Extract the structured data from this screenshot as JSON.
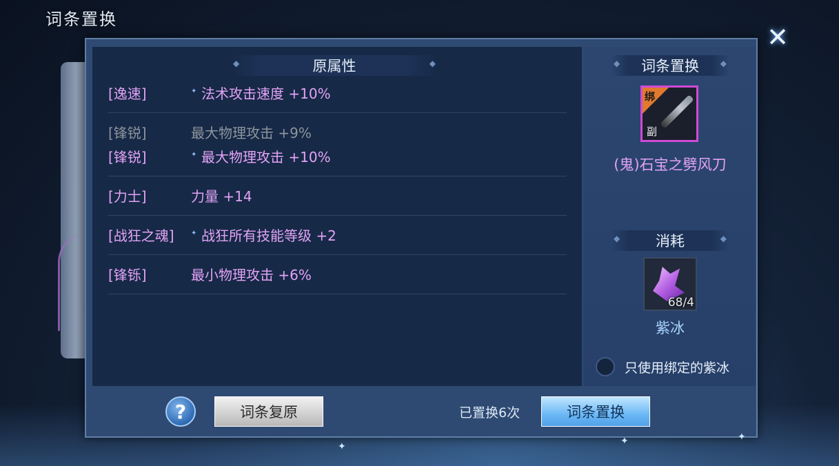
{
  "window": {
    "title": "词条置换",
    "close_icon": "close-icon"
  },
  "left": {
    "header": "原属性",
    "rows": [
      {
        "tag": "[逸速]",
        "desc": "法术攻击速度 +10%",
        "starred": true,
        "old": false
      },
      {
        "tag": "[锋锐]",
        "desc": "最大物理攻击 +9%",
        "starred": false,
        "old": true
      },
      {
        "tag": "[锋锐]",
        "desc": "最大物理攻击 +10%",
        "starred": true,
        "old": false
      },
      {
        "tag": "[力士]",
        "desc": "力量 +14",
        "starred": false,
        "old": false
      },
      {
        "tag": "[战狂之魂]",
        "desc": "战狂所有技能等级 +2",
        "starred": true,
        "old": false
      },
      {
        "tag": "[锋铄]",
        "desc": "最小物理攻击 +6%",
        "starred": false,
        "old": false
      }
    ]
  },
  "right": {
    "header": "词条置换",
    "item": {
      "bind_badge": "绑",
      "sub_badge": "副",
      "name": "(鬼)石宝之劈风刀",
      "icon": "blade-weapon-icon"
    },
    "cost_header": "消耗",
    "material": {
      "count": "68/4",
      "name": "紫冰",
      "icon": "purple-crystal-icon"
    },
    "bound_only_label": "只使用绑定的紫冰"
  },
  "footer": {
    "help_label": "?",
    "restore_label": "词条复原",
    "replace_count": "已置换6次",
    "replace_label": "词条置换"
  },
  "colors": {
    "attribute_text": "#e3a3f5",
    "old_text": "#8e949c",
    "accent_blue": "#6cb8f5",
    "item_border": "#d04ad6"
  }
}
